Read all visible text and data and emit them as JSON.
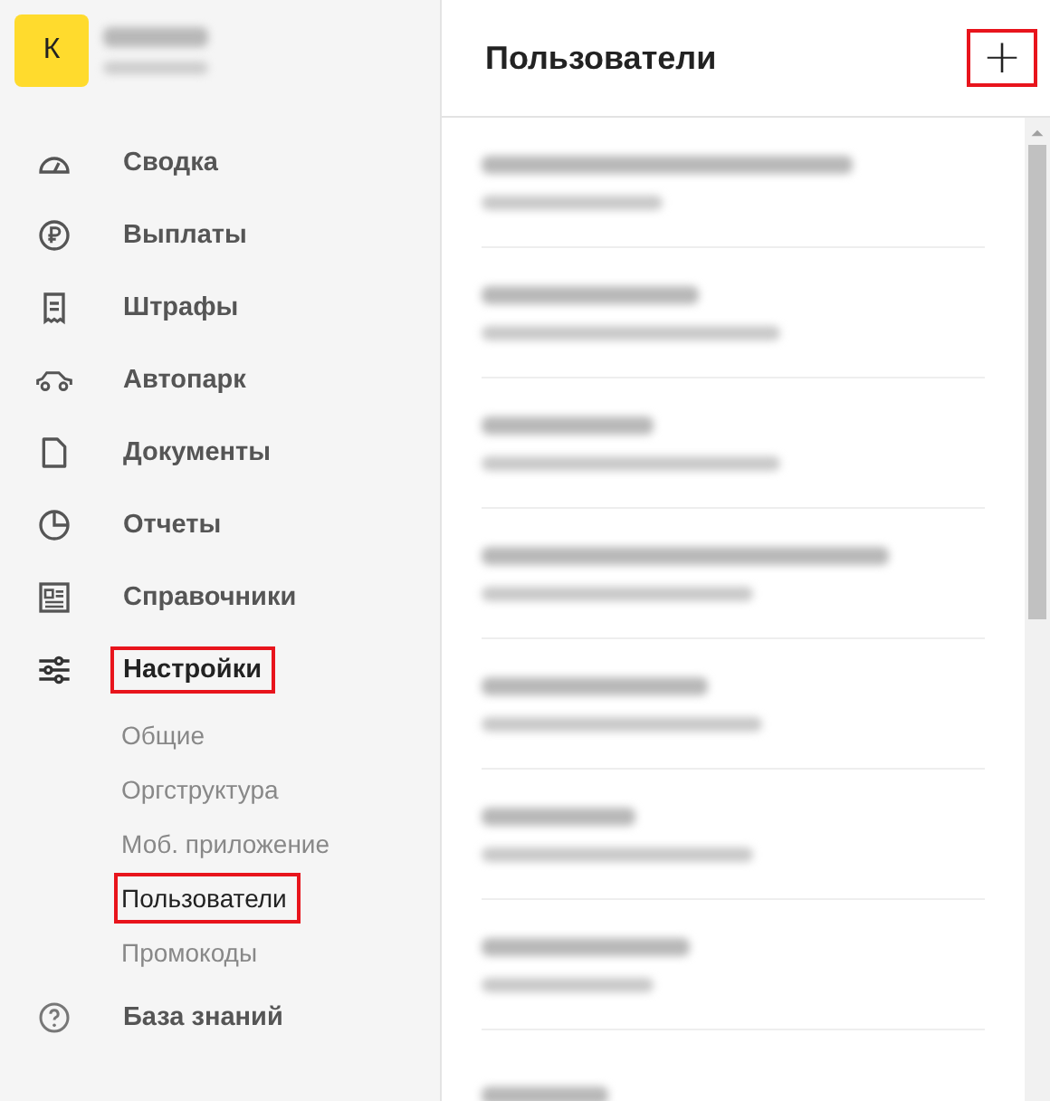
{
  "logo": {
    "letter": "К"
  },
  "nav": [
    {
      "label": "Сводка",
      "selected": false,
      "highlighted": false
    },
    {
      "label": "Выплаты",
      "selected": false,
      "highlighted": false
    },
    {
      "label": "Штрафы",
      "selected": false,
      "highlighted": false
    },
    {
      "label": "Автопарк",
      "selected": false,
      "highlighted": false
    },
    {
      "label": "Документы",
      "selected": false,
      "highlighted": false
    },
    {
      "label": "Отчеты",
      "selected": false,
      "highlighted": false
    },
    {
      "label": "Справочники",
      "selected": false,
      "highlighted": false
    },
    {
      "label": "Настройки",
      "selected": true,
      "highlighted": true,
      "children": [
        {
          "label": "Общие",
          "selected": false,
          "highlighted": false
        },
        {
          "label": "Оргструктура",
          "selected": false,
          "highlighted": false
        },
        {
          "label": "Моб. приложение",
          "selected": false,
          "highlighted": false
        },
        {
          "label": "Пользователи",
          "selected": true,
          "highlighted": true
        },
        {
          "label": "Промокоды",
          "selected": false,
          "highlighted": false
        }
      ]
    },
    {
      "label": "База знаний",
      "selected": false,
      "highlighted": false
    }
  ],
  "header": {
    "title": "Пользователи",
    "add_button": {
      "label": "+",
      "highlighted": true
    }
  },
  "users": [
    {
      "kind": "redacted"
    },
    {
      "kind": "redacted"
    },
    {
      "kind": "redacted"
    },
    {
      "kind": "redacted"
    },
    {
      "kind": "redacted"
    },
    {
      "kind": "redacted"
    },
    {
      "kind": "redacted"
    },
    {
      "kind": "redacted"
    }
  ]
}
